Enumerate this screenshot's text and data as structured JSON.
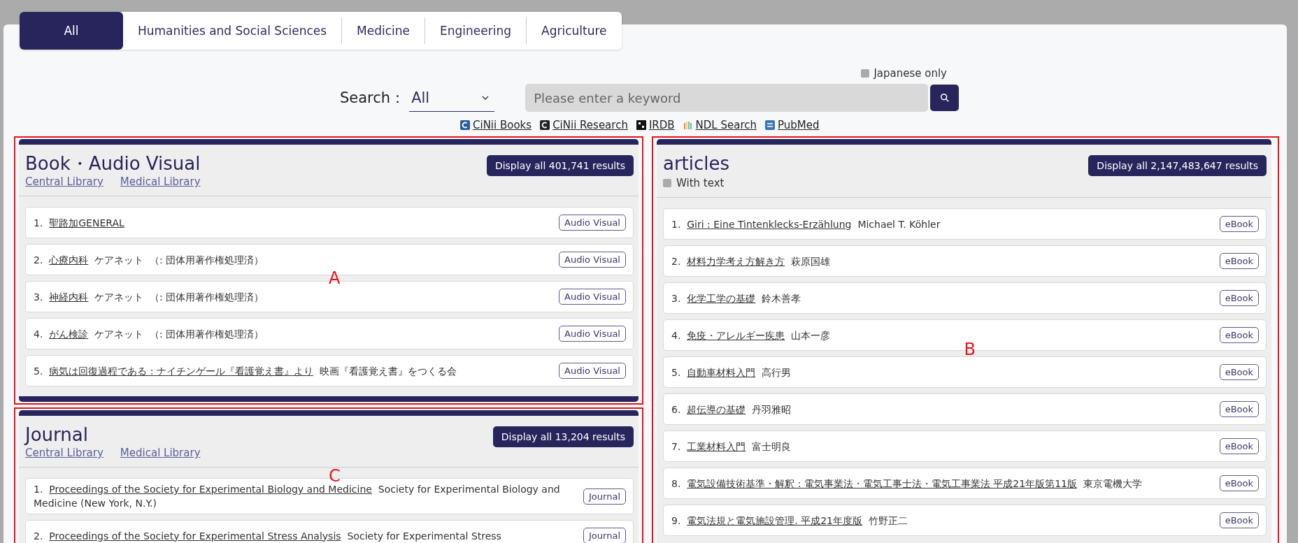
{
  "tabs": [
    {
      "label": "All",
      "selected": true
    },
    {
      "label": "Humanities and Social Sciences",
      "selected": false
    },
    {
      "label": "Medicine",
      "selected": false
    },
    {
      "label": "Engineering",
      "selected": false
    },
    {
      "label": "Agriculture",
      "selected": false
    }
  ],
  "search": {
    "japanese_only": {
      "label": "Japanese only",
      "checked": false
    },
    "label": "Search：",
    "scope": "All",
    "placeholder": "Please enter a keyword"
  },
  "sources": [
    {
      "label": "CiNii Books",
      "kind": "cinii-books"
    },
    {
      "label": "CiNii Research",
      "kind": "cinii-research"
    },
    {
      "label": "IRDB",
      "kind": "irdb"
    },
    {
      "label": "NDL Search",
      "kind": "ndl"
    },
    {
      "label": "PubMed",
      "kind": "pubmed"
    }
  ],
  "columns": [
    {
      "sections": [
        {
          "title": "Book・Audio Visual",
          "annotation": "A",
          "action": "Display all 401,741 results",
          "links": [
            "Central Library",
            "Medical Library"
          ],
          "items": [
            {
              "number": "1.",
              "title": "聖路加GENERAL",
              "badge": "Audio Visual"
            },
            {
              "number": "2.",
              "title": "心療内科",
              "author": "ケアネット",
              "note": "（: 団体用著作権処理済）",
              "badge": "Audio Visual"
            },
            {
              "number": "3.",
              "title": "神経内科",
              "author": "ケアネット",
              "note": "（: 団体用著作権処理済）",
              "badge": "Audio Visual"
            },
            {
              "number": "4.",
              "title": "がん検診",
              "author": "ケアネット",
              "note": "（: 団体用著作権処理済）",
              "badge": "Audio Visual"
            },
            {
              "number": "5.",
              "title": "病気は回復過程である : ナイチンゲール『看護覚え書』より",
              "author": "映画『看護覚え書』をつくる会",
              "badge": "Audio Visual"
            }
          ]
        },
        {
          "title": "Journal",
          "annotation": "C",
          "action": "Display all 13,204 results",
          "links": [
            "Central Library",
            "Medical Library"
          ],
          "items": [
            {
              "number": "1.",
              "title": "Proceedings of the Society for Experimental Biology and Medicine",
              "author": "Society for Experimental Biology and Medicine (New York, N.Y.)",
              "badge": "Journal"
            },
            {
              "number": "2.",
              "title": "Proceedings of the Society for Experimental Stress Analysis",
              "author": "Society for Experimental Stress",
              "badge": "Journal"
            }
          ]
        }
      ]
    },
    {
      "sections": [
        {
          "title": "articles",
          "annotation": "B",
          "action": "Display all 2,147,483,647 results",
          "filter": {
            "label": "With text",
            "checked": false
          },
          "items": [
            {
              "number": "1.",
              "title": "Giri : Eine Tintenklecks-Erzählung",
              "author": "Michael T. Köhler",
              "badge": "eBook"
            },
            {
              "number": "2.",
              "title": "材料力学考え方解き方",
              "author": "萩原国雄",
              "badge": "eBook"
            },
            {
              "number": "3.",
              "title": "化学工学の基礎",
              "author": "鈴木善孝",
              "badge": "eBook"
            },
            {
              "number": "4.",
              "title": "免疫・アレルギー疾患",
              "author": "山本一彦",
              "badge": "eBook"
            },
            {
              "number": "5.",
              "title": "自動車材料入門",
              "author": "高行男",
              "badge": "eBook"
            },
            {
              "number": "6.",
              "title": "超伝導の基礎",
              "author": "丹羽雅昭",
              "badge": "eBook"
            },
            {
              "number": "7.",
              "title": "工業材料入門",
              "author": "富士明良",
              "badge": "eBook"
            },
            {
              "number": "8.",
              "title": "電気設備技術基準・解釈 : 電気事業法・電気工事士法・電気工事業法 平成21年版第11版",
              "author": "東京電機大学",
              "badge": "eBook"
            },
            {
              "number": "9.",
              "title": "電気法規と電気施設管理. 平成21年度版",
              "author": "竹野正二",
              "badge": "eBook"
            }
          ]
        }
      ]
    }
  ]
}
